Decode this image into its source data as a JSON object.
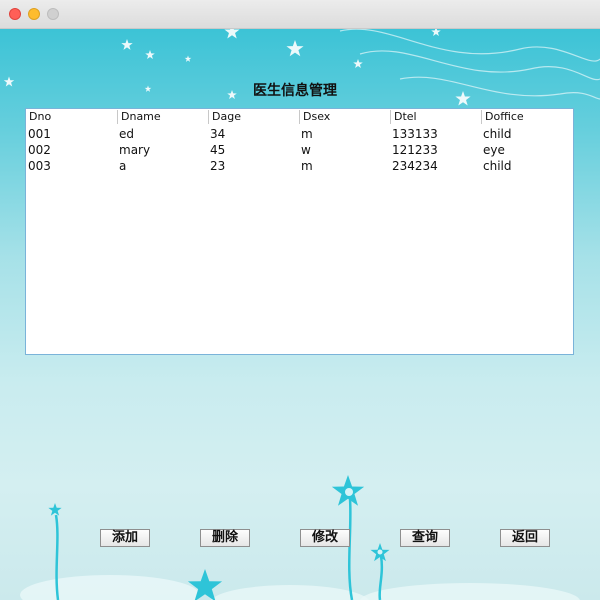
{
  "window": {
    "controls": [
      "close",
      "minimize",
      "maximize"
    ]
  },
  "page": {
    "title": "医生信息管理"
  },
  "table": {
    "columns": [
      "Dno",
      "Dname",
      "Dage",
      "Dsex",
      "Dtel",
      "Doffice"
    ],
    "rows": [
      [
        "001",
        "ed",
        "34",
        "m",
        "133133",
        "child"
      ],
      [
        "002",
        "mary",
        "45",
        "w",
        "121233",
        "eye"
      ],
      [
        "003",
        "a",
        "23",
        "m",
        "234234",
        "child"
      ]
    ]
  },
  "buttons": {
    "add": "添加",
    "delete": "删除",
    "modify": "修改",
    "query": "查询",
    "back": "返回"
  },
  "colors": {
    "accent": "#29b9cf",
    "table_border": "#7ab3d9"
  }
}
